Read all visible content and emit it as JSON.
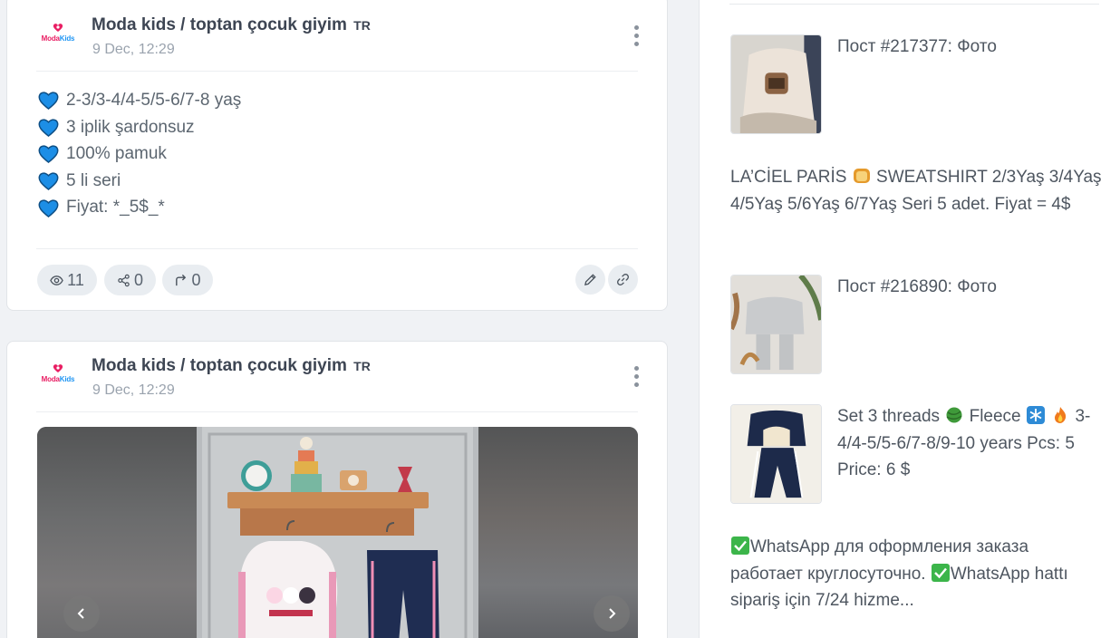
{
  "posts": [
    {
      "channel": "Moda kids / toptan çocuk giyim",
      "lang": "TR",
      "logo_text_a": "Moda",
      "logo_text_b": "Kids",
      "date": "9 Dec, 12:29",
      "lines": [
        "2-3/3-4/4-5/5-6/7-8 yaş",
        "3 iplik şardonsuz",
        "100% pamuk",
        "5 li seri",
        "Fiyat: *_5$_*"
      ],
      "views": "11",
      "shares": "0",
      "forwards": "0"
    },
    {
      "channel": "Moda kids / toptan çocuk giyim",
      "lang": "TR",
      "logo_text_a": "Moda",
      "logo_text_b": "Kids",
      "date": "9 Dec, 12:29"
    }
  ],
  "sidebar": {
    "items": [
      {
        "title": "Пост #217377: Фото"
      },
      {
        "text_a": "LA’CİEL PARİS",
        "text_b": "SWEATSHIRT 2/3Yaş 3/4Yaş 4/5Yaş 5/6Yaş 6/7Yaş Seri 5 adet. Fiyat = 4$"
      },
      {
        "title": "Пост #216890: Фото"
      },
      {
        "text_a": "Set 3 threads",
        "text_b": "Fleece",
        "text_c": "3-4/4-5/5-6/7-8/9-10 years Pcs: 5 Price: 6 $"
      },
      {
        "text_a": "WhatsApp для оформления заказа работает круглосуточно.",
        "text_b": "WhatsApp hattı sipariş için 7/24 hizme..."
      }
    ]
  },
  "icons": {
    "heart": "blue-heart-icon",
    "views": "eye-icon",
    "shares": "share-nodes-icon",
    "forwards": "forward-arrow-icon",
    "edit": "pencil-icon",
    "link": "link-icon",
    "menu": "kebab-menu-icon"
  },
  "colors": {
    "heart": "#1c8ee6",
    "accent_pink": "#e91e63",
    "accent_blue": "#2196f3",
    "check": "#3cb54a"
  }
}
